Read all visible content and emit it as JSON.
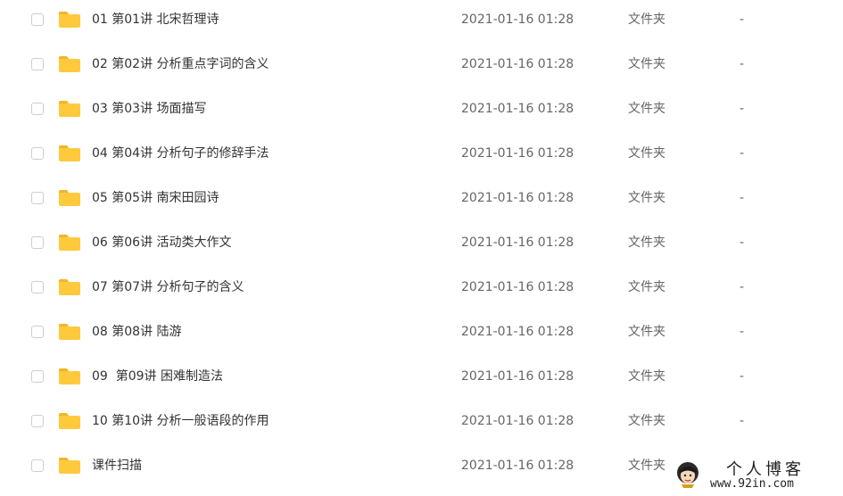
{
  "files": [
    {
      "name": "01 第01讲 北宋哲理诗",
      "date": "2021-01-16 01:28",
      "type": "文件夹",
      "size": "-"
    },
    {
      "name": "02 第02讲 分析重点字词的含义",
      "date": "2021-01-16 01:28",
      "type": "文件夹",
      "size": "-"
    },
    {
      "name": "03 第03讲 场面描写",
      "date": "2021-01-16 01:28",
      "type": "文件夹",
      "size": "-"
    },
    {
      "name": "04 第04讲 分析句子的修辞手法",
      "date": "2021-01-16 01:28",
      "type": "文件夹",
      "size": "-"
    },
    {
      "name": "05 第05讲 南宋田园诗",
      "date": "2021-01-16 01:28",
      "type": "文件夹",
      "size": "-"
    },
    {
      "name": "06 第06讲 活动类大作文",
      "date": "2021-01-16 01:28",
      "type": "文件夹",
      "size": "-"
    },
    {
      "name": "07 第07讲 分析句子的含义",
      "date": "2021-01-16 01:28",
      "type": "文件夹",
      "size": "-"
    },
    {
      "name": "08 第08讲 陆游",
      "date": "2021-01-16 01:28",
      "type": "文件夹",
      "size": "-"
    },
    {
      "name": "09  第09讲 困难制造法",
      "date": "2021-01-16 01:28",
      "type": "文件夹",
      "size": "-"
    },
    {
      "name": "10 第10讲 分析一般语段的作用",
      "date": "2021-01-16 01:28",
      "type": "文件夹",
      "size": "-"
    },
    {
      "name": "课件扫描",
      "date": "2021-01-16 01:28",
      "type": "文件夹",
      "size": ""
    }
  ],
  "watermark": {
    "title": "个人博客",
    "url": "www.92in.com"
  },
  "colors": {
    "folder": "#FFC93C",
    "folder_tab": "#F2B526",
    "text_primary": "#333333",
    "text_secondary": "#666666",
    "checkbox_border": "#C9CED6"
  },
  "icons": {
    "folder": "folder-icon",
    "checkbox": "checkbox",
    "watermark_logo": "avatar-logo"
  }
}
